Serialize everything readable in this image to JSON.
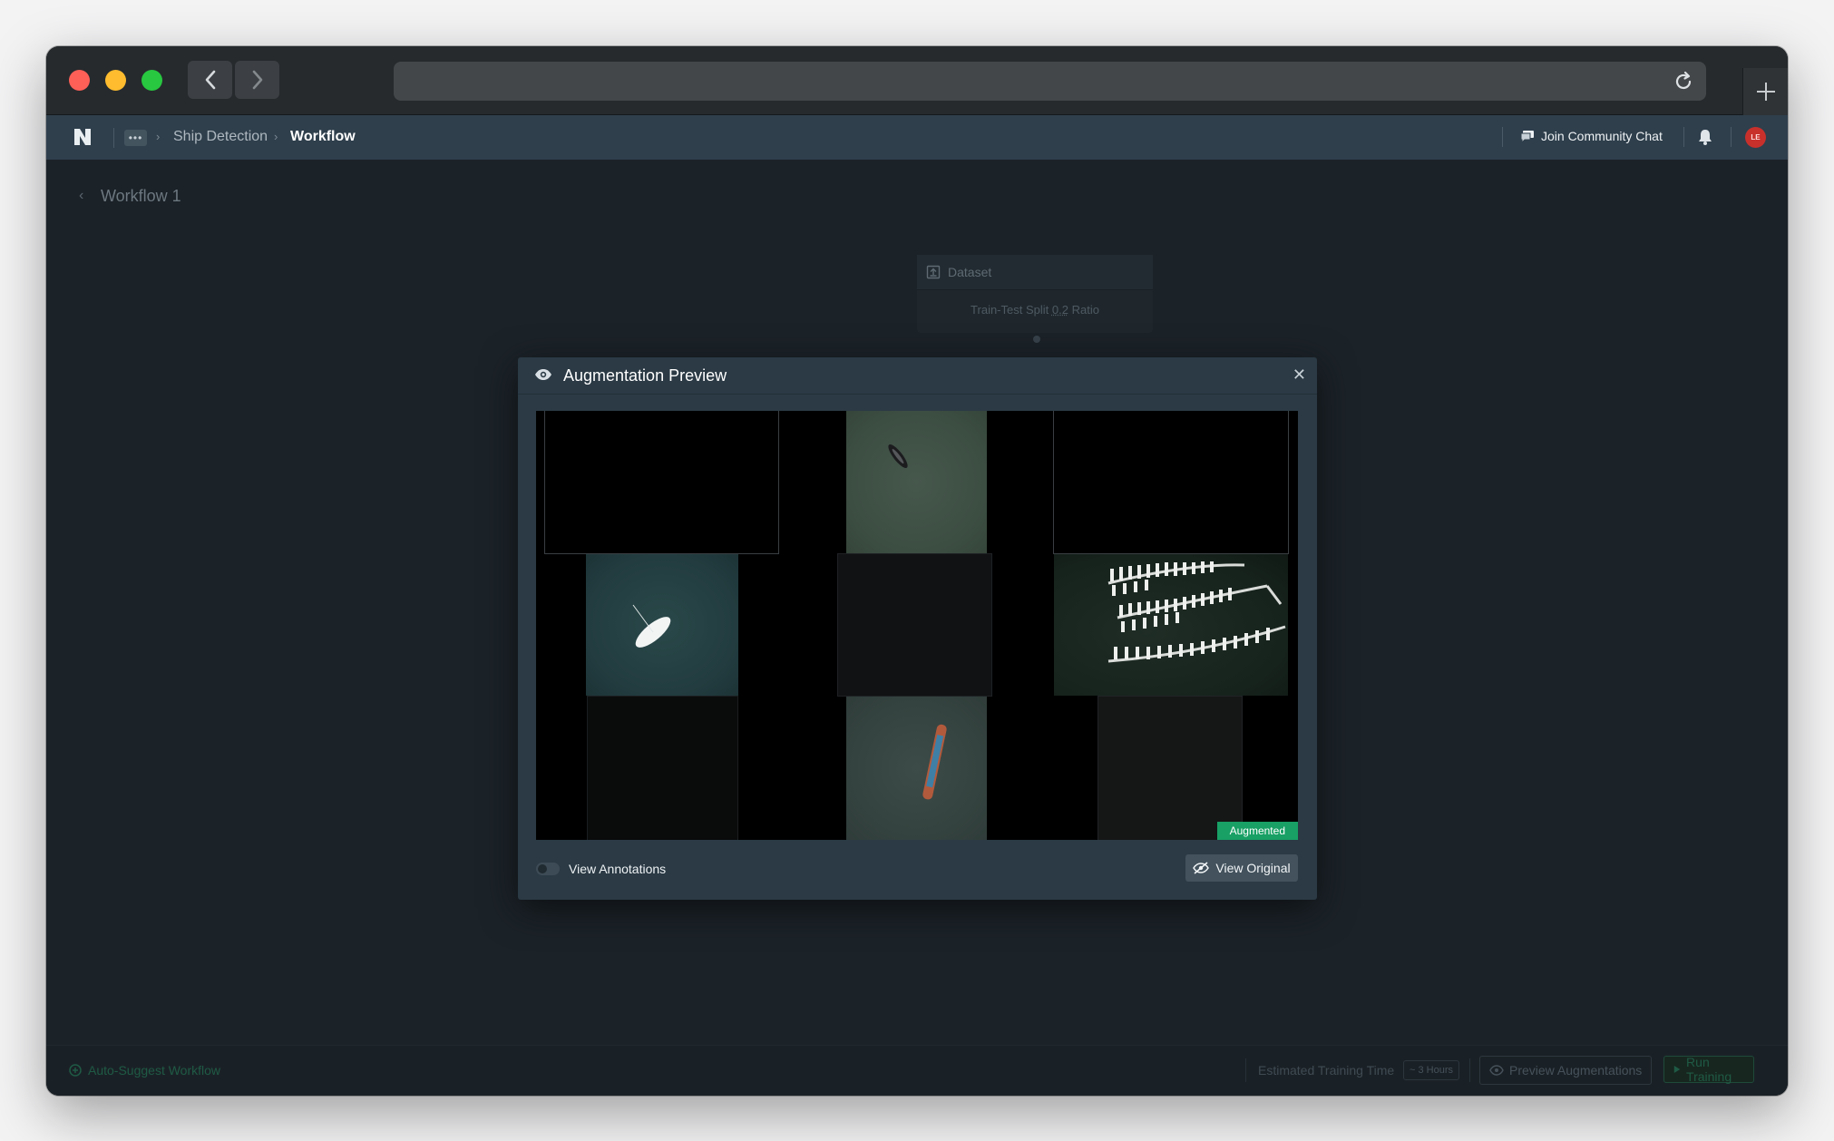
{
  "browser": {
    "back_icon": "chevron-left-icon",
    "forward_icon": "chevron-right-icon",
    "reload_icon": "reload-icon",
    "new_tab_icon": "plus-icon"
  },
  "header": {
    "breadcrumb": [
      "Ship Detection",
      "Workflow"
    ],
    "community_label": "Join Community Chat",
    "avatar_initials": "LE"
  },
  "workflow": {
    "title": "Workflow 1",
    "dataset_node": {
      "title": "Dataset",
      "split_prefix": "Train-Test Split",
      "split_value": "0.2",
      "split_suffix": "Ratio"
    }
  },
  "footer": {
    "auto_suggest_label": "Auto-Suggest Workflow",
    "estimated_label": "Estimated Training Time",
    "estimated_value": "~ 3 Hours",
    "preview_label": "Preview Augmentations",
    "run_label": "Run Training"
  },
  "modal": {
    "title": "Augmentation Preview",
    "augmented_badge": "Augmented",
    "view_annotations_label": "View Annotations",
    "view_annotations_on": false,
    "view_original_label": "View Original"
  },
  "colors": {
    "accent_green": "#18a065",
    "header_bg": "#2f3f4c",
    "modal_bg": "#2b3a45",
    "avatar_red": "#c8302c"
  }
}
